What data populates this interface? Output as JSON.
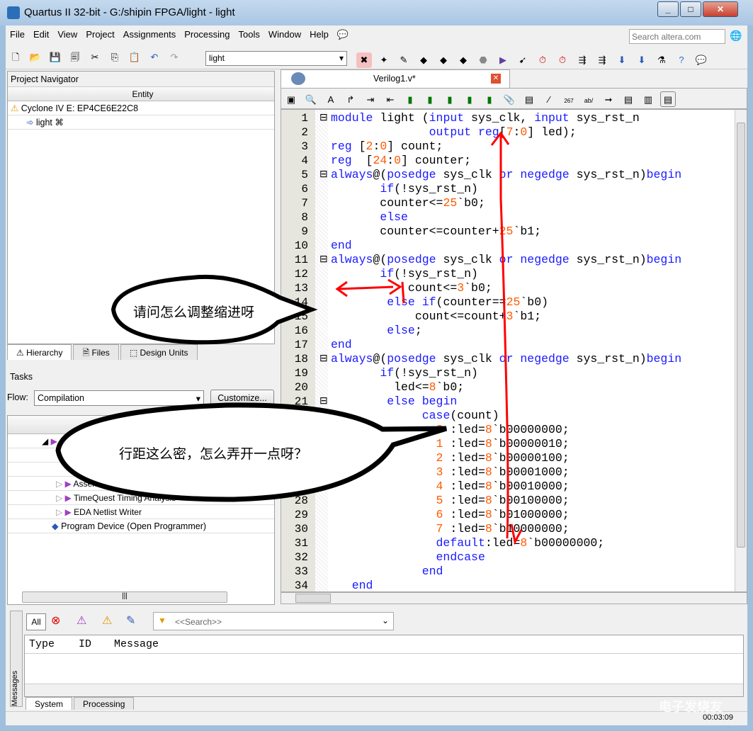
{
  "window": {
    "title": "Quartus II 32-bit - G:/shipin FPGA/light - light"
  },
  "menu": [
    "File",
    "Edit",
    "View",
    "Project",
    "Assignments",
    "Processing",
    "Tools",
    "Window",
    "Help"
  ],
  "search": {
    "placeholder": "Search altera.com"
  },
  "toolbar": {
    "project_select": "light"
  },
  "navigator": {
    "title": "Project Navigator",
    "column": "Entity",
    "device": "Cyclone IV E: EP4CE6E22C8",
    "top": "light",
    "tabs": [
      "Hierarchy",
      "Files",
      "Design Units"
    ]
  },
  "tasks": {
    "title": "Tasks",
    "flow_label": "Flow:",
    "flow_value": "Compilation",
    "customize": "Customize...",
    "items": [
      "Assembler (Generate programming files)",
      "TimeQuest Timing Analysis",
      "EDA Netlist Writer",
      "Program Device (Open Programmer)"
    ]
  },
  "editor": {
    "tab": "Verilog1.v*",
    "lines": [
      [
        [
          "module",
          "kw"
        ],
        [
          " light (",
          "tx"
        ],
        [
          "input",
          "kw"
        ],
        [
          " sys_clk, ",
          "tx"
        ],
        [
          "input",
          "kw"
        ],
        [
          " sys_rst_n",
          "tx"
        ]
      ],
      [
        [
          "              ",
          "tx"
        ],
        [
          "output",
          "kw"
        ],
        [
          " ",
          "tx"
        ],
        [
          "reg",
          "kw"
        ],
        [
          "[",
          "tx"
        ],
        [
          "7",
          "num"
        ],
        [
          ":",
          "tx"
        ],
        [
          "0",
          "num"
        ],
        [
          "] led);",
          "tx"
        ]
      ],
      [
        [
          "reg",
          "kw"
        ],
        [
          " [",
          "tx"
        ],
        [
          "2",
          "num"
        ],
        [
          ":",
          "tx"
        ],
        [
          "0",
          "num"
        ],
        [
          "] count;",
          "tx"
        ]
      ],
      [
        [
          "reg",
          "kw"
        ],
        [
          "  [",
          "tx"
        ],
        [
          "24",
          "num"
        ],
        [
          ":",
          "tx"
        ],
        [
          "0",
          "num"
        ],
        [
          "] counter;",
          "tx"
        ]
      ],
      [
        [
          "always",
          "kw"
        ],
        [
          "@(",
          "tx"
        ],
        [
          "posedge",
          "kw"
        ],
        [
          " sys_clk ",
          "tx"
        ],
        [
          "or",
          "kw"
        ],
        [
          " ",
          "tx"
        ],
        [
          "negedge",
          "kw"
        ],
        [
          " sys_rst_n)",
          "tx"
        ],
        [
          "begin",
          "kw"
        ]
      ],
      [
        [
          "       ",
          "tx"
        ],
        [
          "if",
          "kw"
        ],
        [
          "(!sys_rst_n)",
          "tx"
        ]
      ],
      [
        [
          "       counter<=",
          "tx"
        ],
        [
          "25",
          "num"
        ],
        [
          "`b0;",
          "tx"
        ]
      ],
      [
        [
          "       ",
          "tx"
        ],
        [
          "else",
          "kw"
        ]
      ],
      [
        [
          "       counter<=counter+",
          "tx"
        ],
        [
          "25",
          "num"
        ],
        [
          "`b1;",
          "tx"
        ]
      ],
      [
        [
          "end",
          "kw"
        ]
      ],
      [
        [
          "always",
          "kw"
        ],
        [
          "@(",
          "tx"
        ],
        [
          "posedge",
          "kw"
        ],
        [
          " sys_clk ",
          "tx"
        ],
        [
          "or",
          "kw"
        ],
        [
          " ",
          "tx"
        ],
        [
          "negedge",
          "kw"
        ],
        [
          " sys_rst_n)",
          "tx"
        ],
        [
          "begin",
          "kw"
        ]
      ],
      [
        [
          "       ",
          "tx"
        ],
        [
          "if",
          "kw"
        ],
        [
          "(!sys_rst_n)",
          "tx"
        ]
      ],
      [
        [
          "           count<=",
          "tx"
        ],
        [
          "3",
          "num"
        ],
        [
          "`b0;",
          "tx"
        ]
      ],
      [
        [
          "        ",
          "tx"
        ],
        [
          "else",
          "kw"
        ],
        [
          " ",
          "tx"
        ],
        [
          "if",
          "kw"
        ],
        [
          "(counter==",
          "tx"
        ],
        [
          "25",
          "num"
        ],
        [
          "`b0)",
          "tx"
        ]
      ],
      [
        [
          "            count<=count+",
          "tx"
        ],
        [
          "3",
          "num"
        ],
        [
          "`b1;",
          "tx"
        ]
      ],
      [
        [
          "        ",
          "tx"
        ],
        [
          "else",
          "kw"
        ],
        [
          ";",
          "tx"
        ]
      ],
      [
        [
          "end",
          "kw"
        ]
      ],
      [
        [
          "always",
          "kw"
        ],
        [
          "@(",
          "tx"
        ],
        [
          "posedge",
          "kw"
        ],
        [
          " sys_clk ",
          "tx"
        ],
        [
          "or",
          "kw"
        ],
        [
          " ",
          "tx"
        ],
        [
          "negedge",
          "kw"
        ],
        [
          " sys_rst_n)",
          "tx"
        ],
        [
          "begin",
          "kw"
        ]
      ],
      [
        [
          "       ",
          "tx"
        ],
        [
          "if",
          "kw"
        ],
        [
          "(!sys_rst_n)",
          "tx"
        ]
      ],
      [
        [
          "         led<=",
          "tx"
        ],
        [
          "8",
          "num"
        ],
        [
          "`b0;",
          "tx"
        ]
      ],
      [
        [
          "        ",
          "tx"
        ],
        [
          "else",
          "kw"
        ],
        [
          " ",
          "tx"
        ],
        [
          "begin",
          "kw"
        ]
      ],
      [
        [
          "             ",
          "tx"
        ],
        [
          "case",
          "kw"
        ],
        [
          "(count)",
          "tx"
        ]
      ],
      [
        [
          "               ",
          "tx"
        ],
        [
          "0",
          "num"
        ],
        [
          " :led=",
          "tx"
        ],
        [
          "8",
          "num"
        ],
        [
          "`b00000000;",
          "tx"
        ]
      ],
      [
        [
          "               ",
          "tx"
        ],
        [
          "1",
          "num"
        ],
        [
          " :led=",
          "tx"
        ],
        [
          "8",
          "num"
        ],
        [
          "`b00000010;",
          "tx"
        ]
      ],
      [
        [
          "               ",
          "tx"
        ],
        [
          "2",
          "num"
        ],
        [
          " :led=",
          "tx"
        ],
        [
          "8",
          "num"
        ],
        [
          "`b00000100;",
          "tx"
        ]
      ],
      [
        [
          "               ",
          "tx"
        ],
        [
          "3",
          "num"
        ],
        [
          " :led=",
          "tx"
        ],
        [
          "8",
          "num"
        ],
        [
          "`b00001000;",
          "tx"
        ]
      ],
      [
        [
          "               ",
          "tx"
        ],
        [
          "4",
          "num"
        ],
        [
          " :led=",
          "tx"
        ],
        [
          "8",
          "num"
        ],
        [
          "`b00010000;",
          "tx"
        ]
      ],
      [
        [
          "               ",
          "tx"
        ],
        [
          "5",
          "num"
        ],
        [
          " :led=",
          "tx"
        ],
        [
          "8",
          "num"
        ],
        [
          "`b00100000;",
          "tx"
        ]
      ],
      [
        [
          "               ",
          "tx"
        ],
        [
          "6",
          "num"
        ],
        [
          " :led=",
          "tx"
        ],
        [
          "8",
          "num"
        ],
        [
          "`b01000000;",
          "tx"
        ]
      ],
      [
        [
          "               ",
          "tx"
        ],
        [
          "7",
          "num"
        ],
        [
          " :led=",
          "tx"
        ],
        [
          "8",
          "num"
        ],
        [
          "`b10000000;",
          "tx"
        ]
      ],
      [
        [
          "               ",
          "tx"
        ],
        [
          "default",
          "kw"
        ],
        [
          ":led=",
          "tx"
        ],
        [
          "8",
          "num"
        ],
        [
          "`b00000000;",
          "tx"
        ]
      ],
      [
        [
          "               ",
          "tx"
        ],
        [
          "endcase",
          "kw"
        ]
      ],
      [
        [
          "             ",
          "tx"
        ],
        [
          "end",
          "kw"
        ]
      ],
      [
        [
          "   ",
          "tx"
        ],
        [
          "end",
          "kw"
        ]
      ]
    ]
  },
  "messages": {
    "filter_all": "All",
    "search_placeholder": "<<Search>>",
    "columns": [
      "Type",
      "ID",
      "Message"
    ],
    "tabs": [
      "System",
      "Processing"
    ],
    "side_label": "Messages",
    "time": "00:03:09"
  },
  "annotations": {
    "bubble1": "请问怎么调整缩进呀",
    "bubble2": "行距这么密，怎么弄开一点呀？",
    "watermark": "电子发烧友"
  },
  "colors": {
    "keyword": "#1a1aff",
    "number": "#ff5a00",
    "annotation": "#ff0000"
  }
}
